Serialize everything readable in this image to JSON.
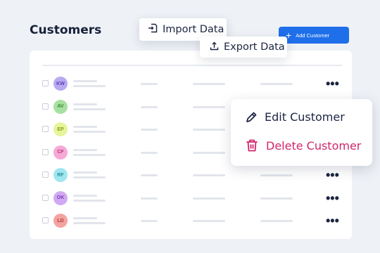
{
  "header": {
    "title": "Customers",
    "add_button_label": "Add Customer",
    "import_label": "Import Data",
    "export_label": "Export Data"
  },
  "table": {
    "rows": [
      {
        "initials": "KW",
        "avatar_bg": "#b9a9f0",
        "avatar_fg": "#5a3fb8"
      },
      {
        "initials": "AV",
        "avatar_bg": "#a7e0a0",
        "avatar_fg": "#3a8a32"
      },
      {
        "initials": "EP",
        "avatar_bg": "#e6f59a",
        "avatar_fg": "#8a9a1e"
      },
      {
        "initials": "CF",
        "avatar_bg": "#f7a9d6",
        "avatar_fg": "#b2397c"
      },
      {
        "initials": "RF",
        "avatar_bg": "#9fe7f0",
        "avatar_fg": "#2c8e9a"
      },
      {
        "initials": "OK",
        "avatar_bg": "#d0a9f2",
        "avatar_fg": "#7d3fb8"
      },
      {
        "initials": "LD",
        "avatar_bg": "#f3a3a0",
        "avatar_fg": "#b83a35"
      }
    ],
    "more_glyph": "•••"
  },
  "context_menu": {
    "edit_label": "Edit Customer",
    "delete_label": "Delete Customer"
  },
  "colors": {
    "accent": "#1f6fea",
    "danger": "#d0276b"
  }
}
